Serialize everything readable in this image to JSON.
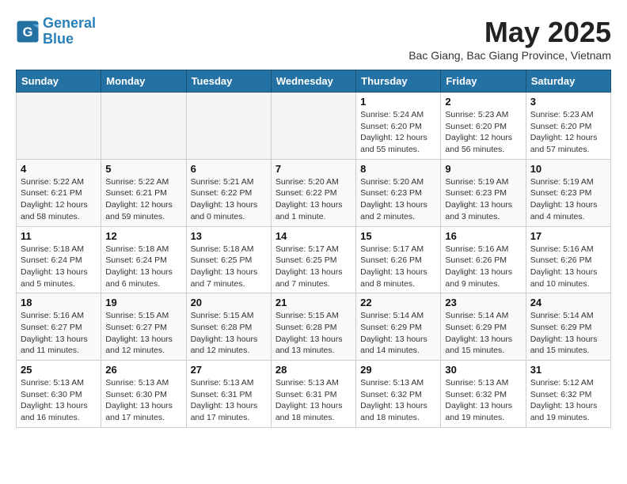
{
  "header": {
    "logo_line1": "General",
    "logo_line2": "Blue",
    "month_title": "May 2025",
    "location": "Bac Giang, Bac Giang Province, Vietnam"
  },
  "columns": [
    "Sunday",
    "Monday",
    "Tuesday",
    "Wednesday",
    "Thursday",
    "Friday",
    "Saturday"
  ],
  "weeks": [
    [
      {
        "day": "",
        "info": ""
      },
      {
        "day": "",
        "info": ""
      },
      {
        "day": "",
        "info": ""
      },
      {
        "day": "",
        "info": ""
      },
      {
        "day": "1",
        "info": "Sunrise: 5:24 AM\nSunset: 6:20 PM\nDaylight: 12 hours\nand 55 minutes."
      },
      {
        "day": "2",
        "info": "Sunrise: 5:23 AM\nSunset: 6:20 PM\nDaylight: 12 hours\nand 56 minutes."
      },
      {
        "day": "3",
        "info": "Sunrise: 5:23 AM\nSunset: 6:20 PM\nDaylight: 12 hours\nand 57 minutes."
      }
    ],
    [
      {
        "day": "4",
        "info": "Sunrise: 5:22 AM\nSunset: 6:21 PM\nDaylight: 12 hours\nand 58 minutes."
      },
      {
        "day": "5",
        "info": "Sunrise: 5:22 AM\nSunset: 6:21 PM\nDaylight: 12 hours\nand 59 minutes."
      },
      {
        "day": "6",
        "info": "Sunrise: 5:21 AM\nSunset: 6:22 PM\nDaylight: 13 hours\nand 0 minutes."
      },
      {
        "day": "7",
        "info": "Sunrise: 5:20 AM\nSunset: 6:22 PM\nDaylight: 13 hours\nand 1 minute."
      },
      {
        "day": "8",
        "info": "Sunrise: 5:20 AM\nSunset: 6:23 PM\nDaylight: 13 hours\nand 2 minutes."
      },
      {
        "day": "9",
        "info": "Sunrise: 5:19 AM\nSunset: 6:23 PM\nDaylight: 13 hours\nand 3 minutes."
      },
      {
        "day": "10",
        "info": "Sunrise: 5:19 AM\nSunset: 6:23 PM\nDaylight: 13 hours\nand 4 minutes."
      }
    ],
    [
      {
        "day": "11",
        "info": "Sunrise: 5:18 AM\nSunset: 6:24 PM\nDaylight: 13 hours\nand 5 minutes."
      },
      {
        "day": "12",
        "info": "Sunrise: 5:18 AM\nSunset: 6:24 PM\nDaylight: 13 hours\nand 6 minutes."
      },
      {
        "day": "13",
        "info": "Sunrise: 5:18 AM\nSunset: 6:25 PM\nDaylight: 13 hours\nand 7 minutes."
      },
      {
        "day": "14",
        "info": "Sunrise: 5:17 AM\nSunset: 6:25 PM\nDaylight: 13 hours\nand 7 minutes."
      },
      {
        "day": "15",
        "info": "Sunrise: 5:17 AM\nSunset: 6:26 PM\nDaylight: 13 hours\nand 8 minutes."
      },
      {
        "day": "16",
        "info": "Sunrise: 5:16 AM\nSunset: 6:26 PM\nDaylight: 13 hours\nand 9 minutes."
      },
      {
        "day": "17",
        "info": "Sunrise: 5:16 AM\nSunset: 6:26 PM\nDaylight: 13 hours\nand 10 minutes."
      }
    ],
    [
      {
        "day": "18",
        "info": "Sunrise: 5:16 AM\nSunset: 6:27 PM\nDaylight: 13 hours\nand 11 minutes."
      },
      {
        "day": "19",
        "info": "Sunrise: 5:15 AM\nSunset: 6:27 PM\nDaylight: 13 hours\nand 12 minutes."
      },
      {
        "day": "20",
        "info": "Sunrise: 5:15 AM\nSunset: 6:28 PM\nDaylight: 13 hours\nand 12 minutes."
      },
      {
        "day": "21",
        "info": "Sunrise: 5:15 AM\nSunset: 6:28 PM\nDaylight: 13 hours\nand 13 minutes."
      },
      {
        "day": "22",
        "info": "Sunrise: 5:14 AM\nSunset: 6:29 PM\nDaylight: 13 hours\nand 14 minutes."
      },
      {
        "day": "23",
        "info": "Sunrise: 5:14 AM\nSunset: 6:29 PM\nDaylight: 13 hours\nand 15 minutes."
      },
      {
        "day": "24",
        "info": "Sunrise: 5:14 AM\nSunset: 6:29 PM\nDaylight: 13 hours\nand 15 minutes."
      }
    ],
    [
      {
        "day": "25",
        "info": "Sunrise: 5:13 AM\nSunset: 6:30 PM\nDaylight: 13 hours\nand 16 minutes."
      },
      {
        "day": "26",
        "info": "Sunrise: 5:13 AM\nSunset: 6:30 PM\nDaylight: 13 hours\nand 17 minutes."
      },
      {
        "day": "27",
        "info": "Sunrise: 5:13 AM\nSunset: 6:31 PM\nDaylight: 13 hours\nand 17 minutes."
      },
      {
        "day": "28",
        "info": "Sunrise: 5:13 AM\nSunset: 6:31 PM\nDaylight: 13 hours\nand 18 minutes."
      },
      {
        "day": "29",
        "info": "Sunrise: 5:13 AM\nSunset: 6:32 PM\nDaylight: 13 hours\nand 18 minutes."
      },
      {
        "day": "30",
        "info": "Sunrise: 5:13 AM\nSunset: 6:32 PM\nDaylight: 13 hours\nand 19 minutes."
      },
      {
        "day": "31",
        "info": "Sunrise: 5:12 AM\nSunset: 6:32 PM\nDaylight: 13 hours\nand 19 minutes."
      }
    ]
  ]
}
